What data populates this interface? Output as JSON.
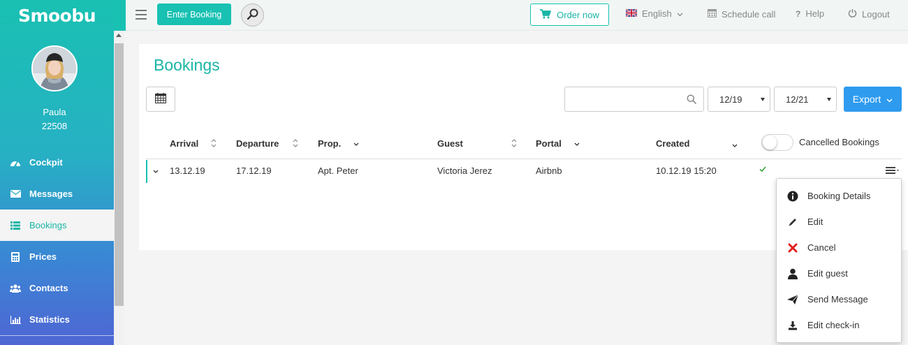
{
  "app": {
    "logo_text": "Smoobu",
    "brand_color": "#19c1b2"
  },
  "user": {
    "name": "Paula",
    "id": "22508"
  },
  "sidebar": {
    "items": [
      {
        "label": "Cockpit",
        "icon": "dashboard-icon"
      },
      {
        "label": "Messages",
        "icon": "envelope-icon"
      },
      {
        "label": "Bookings",
        "icon": "list-icon",
        "active": true
      },
      {
        "label": "Prices",
        "icon": "calculator-icon"
      },
      {
        "label": "Contacts",
        "icon": "users-icon"
      },
      {
        "label": "Statistics",
        "icon": "bar-chart-icon"
      }
    ]
  },
  "topbar": {
    "enter_booking_label": "Enter Booking",
    "order_now_label": "Order now",
    "language_label": "English",
    "schedule_call_label": "Schedule call",
    "help_label": "Help",
    "logout_label": "Logout"
  },
  "main": {
    "title": "Bookings",
    "search": {
      "value": "",
      "placeholder": ""
    },
    "filter_from": "12/19",
    "filter_to": "12/21",
    "export_label": "Export",
    "cancelled_toggle_label": "Cancelled Bookings",
    "cancelled_toggle_on": false,
    "columns": [
      "Arrival",
      "Departure",
      "Prop.",
      "Guest",
      "Portal",
      "Created"
    ],
    "rows": [
      {
        "arrival": "13.12.19",
        "departure": "17.12.19",
        "property": "Apt. Peter",
        "guest": "Victoria Jerez",
        "portal": "Airbnb",
        "created": "10.12.19 15:20",
        "confirmed": true
      }
    ]
  },
  "row_menu": {
    "items": [
      {
        "label": "Booking Details",
        "icon": "info-icon"
      },
      {
        "label": "Edit",
        "icon": "pencil-icon"
      },
      {
        "label": "Cancel",
        "icon": "cross-icon",
        "color": "#e02020"
      },
      {
        "label": "Edit guest",
        "icon": "user-icon"
      },
      {
        "label": "Send Message",
        "icon": "paper-plane-icon"
      },
      {
        "label": "Edit check-in",
        "icon": "download-icon"
      }
    ]
  },
  "colors": {
    "accent": "#19c1b2",
    "export_blue": "#2e9bef",
    "check_green": "#2ca02c"
  }
}
